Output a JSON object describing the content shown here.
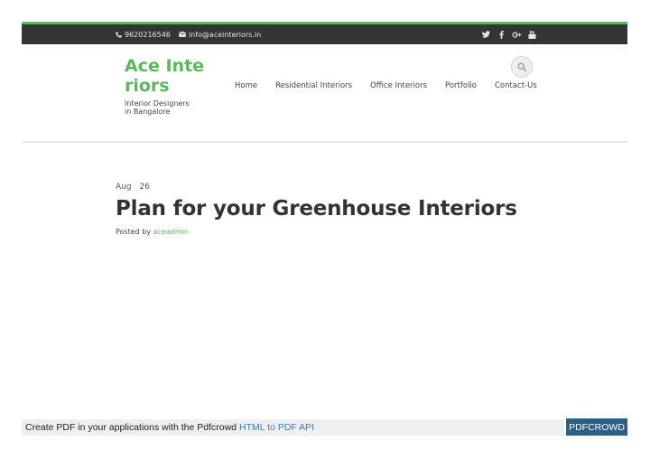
{
  "topbar": {
    "phone": "9620216546",
    "email": "info@aceinteriors.in",
    "social_icons": [
      "twitter-icon",
      "facebook-icon",
      "google-plus-icon",
      "youtube-icon"
    ]
  },
  "brand": {
    "name": "Ace Interiors",
    "tagline": "Interior Designers in Bangalore"
  },
  "nav": {
    "items": [
      "Home",
      "Residential Interiors",
      "Office Interiors",
      "Portfolio",
      "Contact-Us"
    ]
  },
  "search": {
    "icon": "search-icon"
  },
  "post": {
    "month": "Aug",
    "day": "26",
    "title": "Plan for your Greenhouse Interiors",
    "posted_by_label": "Posted by",
    "author": "aceadmin"
  },
  "pdfcrowd": {
    "text": "Create PDF in your applications with the Pdfcrowd",
    "link": "HTML to PDF API",
    "badge": "PDFCROWD"
  },
  "colors": {
    "accent": "#5cb85c",
    "topbar_bg": "#333435",
    "pdf_badge_bg": "#2c5f86",
    "link_blue": "#3b7dc4"
  }
}
